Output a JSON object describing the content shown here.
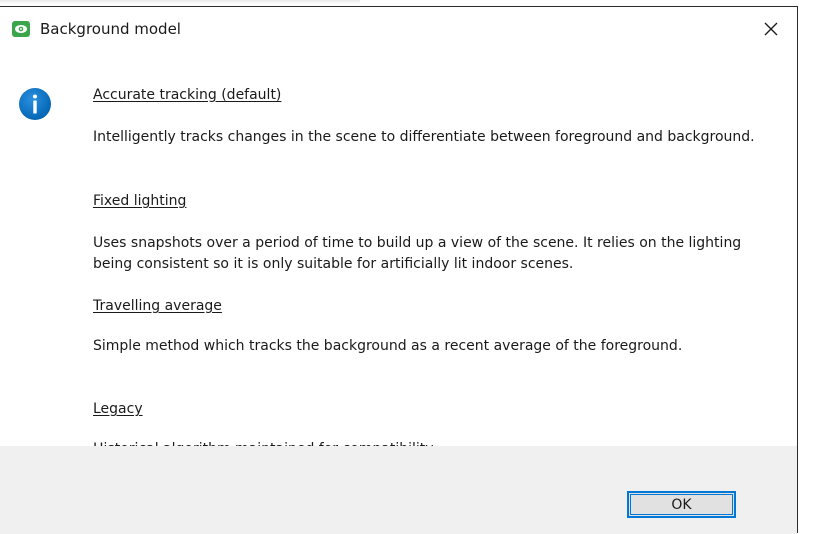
{
  "window": {
    "title": "Background model",
    "app_icon": "eye-icon",
    "close_icon": "close-icon",
    "accent_color": "#0078d7"
  },
  "dialog": {
    "icon": "info-icon",
    "icon_color": "#0063b1",
    "sections": [
      {
        "title": "Accurate tracking (default)",
        "description": "Intelligently tracks changes in the scene to differentiate between foreground and background."
      },
      {
        "title": "Fixed lighting",
        "description": "Uses snapshots over a period of time to build up a view of the scene. It relies on the lighting being consistent so it is only suitable for artificially lit indoor scenes."
      },
      {
        "title": "Travelling average",
        "description": "Simple method which tracks the background as a recent average of the foreground."
      },
      {
        "title": "Legacy",
        "description": "Historical algorithm maintained for compatibility."
      }
    ]
  },
  "footer": {
    "ok_label": "OK"
  }
}
